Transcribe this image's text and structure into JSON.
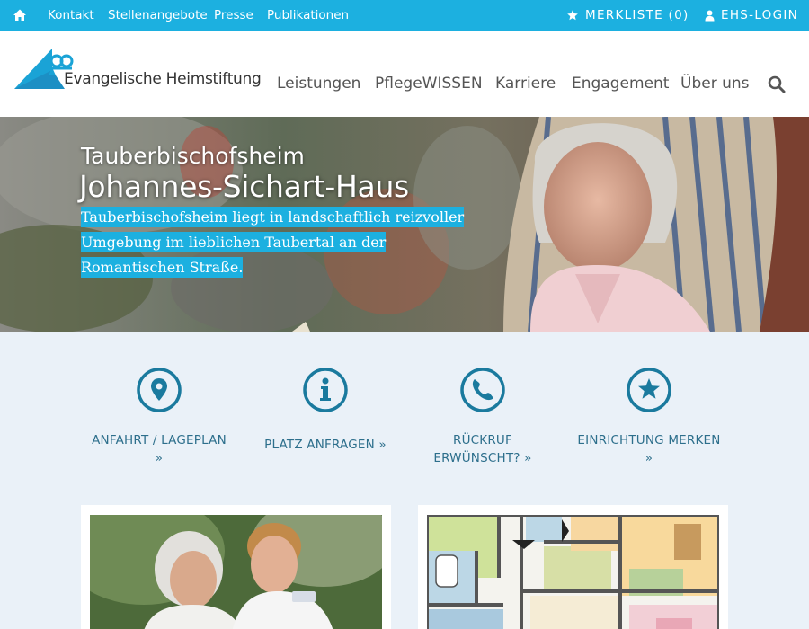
{
  "topbar": {
    "links": [
      "Kontakt",
      "Stellenangebote",
      "Presse",
      "Publikationen"
    ],
    "merkliste": "MERKLISTE (0)",
    "login": "EHS-LOGIN"
  },
  "logo": {
    "text": "Evangelische Heimstiftung"
  },
  "nav": {
    "items": [
      "Leistungen",
      "PflegeWISSEN",
      "Karriere",
      "Engagement",
      "Über uns"
    ]
  },
  "hero": {
    "location": "Tauberbischofsheim",
    "name": "Johannes-Sichart-Haus",
    "description": "Tauberbischofsheim liegt in landschaftlich reizvoller Umgebung im lieblichen Taubertal an der Romantischen Straße."
  },
  "actions": [
    {
      "label_line1": "ANFAHRT / LAGEPLAN",
      "label_line2": "»",
      "icon": "map-marker-icon"
    },
    {
      "label_line1": "PLATZ ANFRAGEN »",
      "label_line2": "",
      "icon": "info-icon"
    },
    {
      "label_line1": "RÜCKRUF",
      "label_line2": "ERWÜNSCHT? »",
      "icon": "phone-icon"
    },
    {
      "label_line1": "EINRICHTUNG MERKEN",
      "label_line2": "»",
      "icon": "star-icon"
    }
  ],
  "colors": {
    "accent": "#1cb0e0",
    "text_blue": "#2d6f8c",
    "icon_blue": "#1a7a9e",
    "bg": "#eaf1f8"
  }
}
